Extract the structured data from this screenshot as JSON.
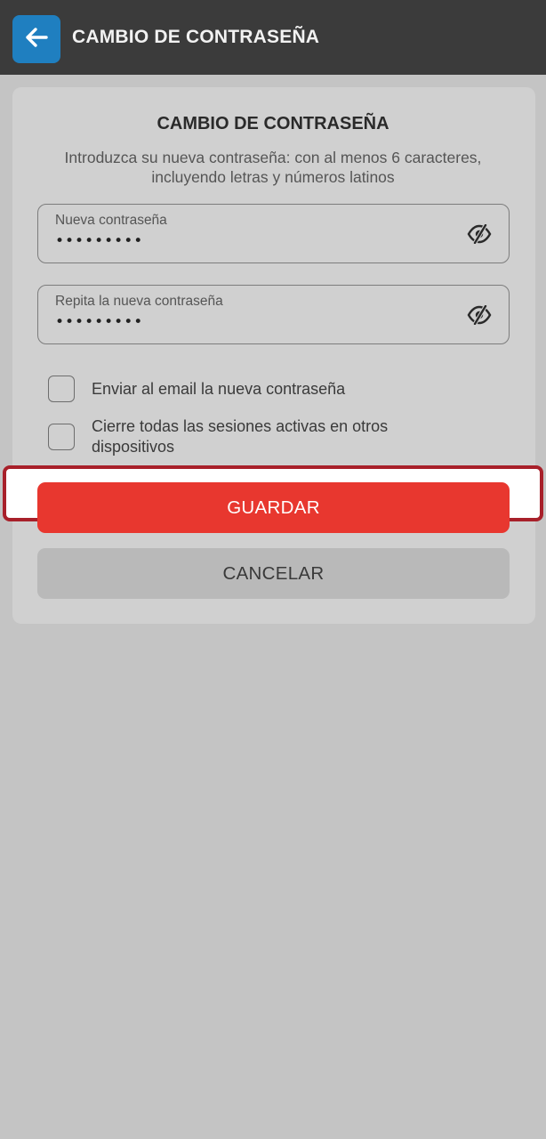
{
  "header": {
    "back_icon": "arrow-left-icon",
    "title": "CAMBIO DE CONTRASEÑA",
    "background_color": "#3b3b3b",
    "back_button_color": "#1f7fc0"
  },
  "form": {
    "title": "CAMBIO DE CONTRASEÑA",
    "description": "Introduzca su nueva contraseña: con al menos 6 caracteres, incluyendo letras y números latinos",
    "fields": [
      {
        "label": "Nueva contraseña",
        "value": "•••••••••",
        "icon": "eye-slash-icon"
      },
      {
        "label": "Repita la nueva contraseña",
        "value": "•••••••••",
        "icon": "eye-slash-icon"
      }
    ],
    "checkboxes": [
      {
        "label": "Enviar al email la nueva contraseña",
        "checked": false
      },
      {
        "label": "Cierre todas las sesiones activas en otros dispositivos",
        "checked": false
      }
    ],
    "save_label": "GUARDAR",
    "cancel_label": "CANCELAR",
    "save_color": "#e8372f",
    "highlight_color": "#a8202a"
  }
}
